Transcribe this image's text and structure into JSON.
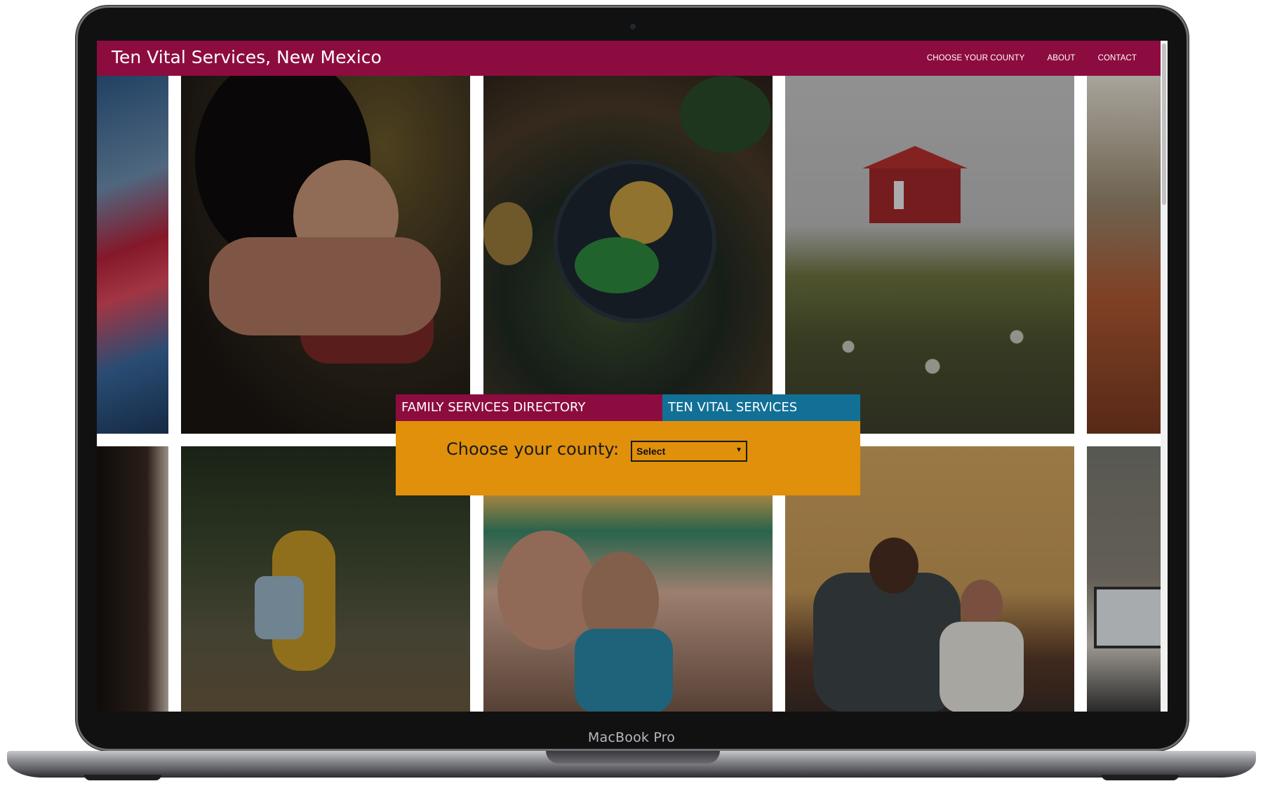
{
  "device": {
    "label": "MacBook Pro"
  },
  "navbar": {
    "title": "Ten Vital Services, New Mexico",
    "links": [
      "CHOOSE YOUR COUNTY",
      "ABOUT",
      "CONTACT"
    ]
  },
  "panel": {
    "tabs": [
      "FAMILY SERVICES DIRECTORY",
      "TEN VITAL SERVICES"
    ],
    "county_label": "Choose your county:",
    "select_value": "Select"
  },
  "colors": {
    "brand": "#8c0c40",
    "tab_secondary": "#127096",
    "panel": "#e0900a"
  },
  "icons": {
    "select_chevron": "chevron-down-icon"
  }
}
